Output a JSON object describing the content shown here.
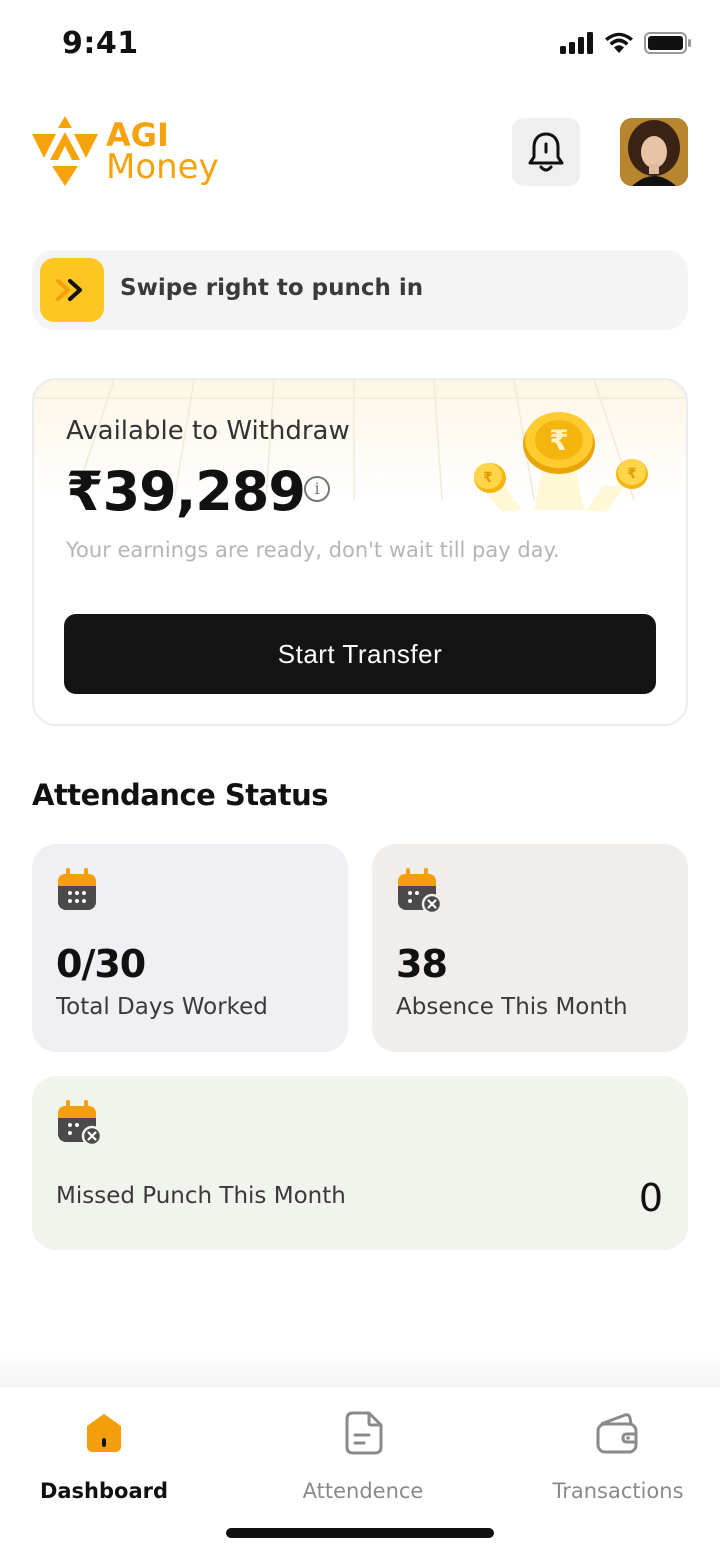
{
  "status_bar": {
    "time": "9:41",
    "icons": [
      "signal-icon",
      "wifi-icon",
      "battery-icon"
    ]
  },
  "header": {
    "logo_line1": "AGI",
    "logo_line2": "Money",
    "brand_color": "#F5A20B",
    "icons": [
      "bell-icon",
      "avatar"
    ]
  },
  "swipe": {
    "label": "Swipe right to punch in",
    "accent": "#FFC523"
  },
  "withdraw": {
    "title": "Available to Withdraw",
    "amount": "₹39,289",
    "info_glyph": "i",
    "subtitle": "Your earnings are ready, don't wait till pay day.",
    "button_label": "Start Transfer"
  },
  "attendance": {
    "title": "Attendance Status",
    "cards": [
      {
        "value": "0/30",
        "label": "Total Days Worked",
        "icon": "calendar-icon"
      },
      {
        "value": "38",
        "label": "Absence This Month",
        "icon": "calendar-cross-icon"
      },
      {
        "value": "0",
        "label": "Missed Punch This Month",
        "icon": "calendar-cross-icon"
      }
    ]
  },
  "nav": {
    "items": [
      {
        "label": "Dashboard",
        "icon": "home-icon",
        "active": true
      },
      {
        "label": "Attendence",
        "icon": "document-icon",
        "active": false
      },
      {
        "label": "Transactions",
        "icon": "wallet-icon",
        "active": false
      }
    ]
  }
}
